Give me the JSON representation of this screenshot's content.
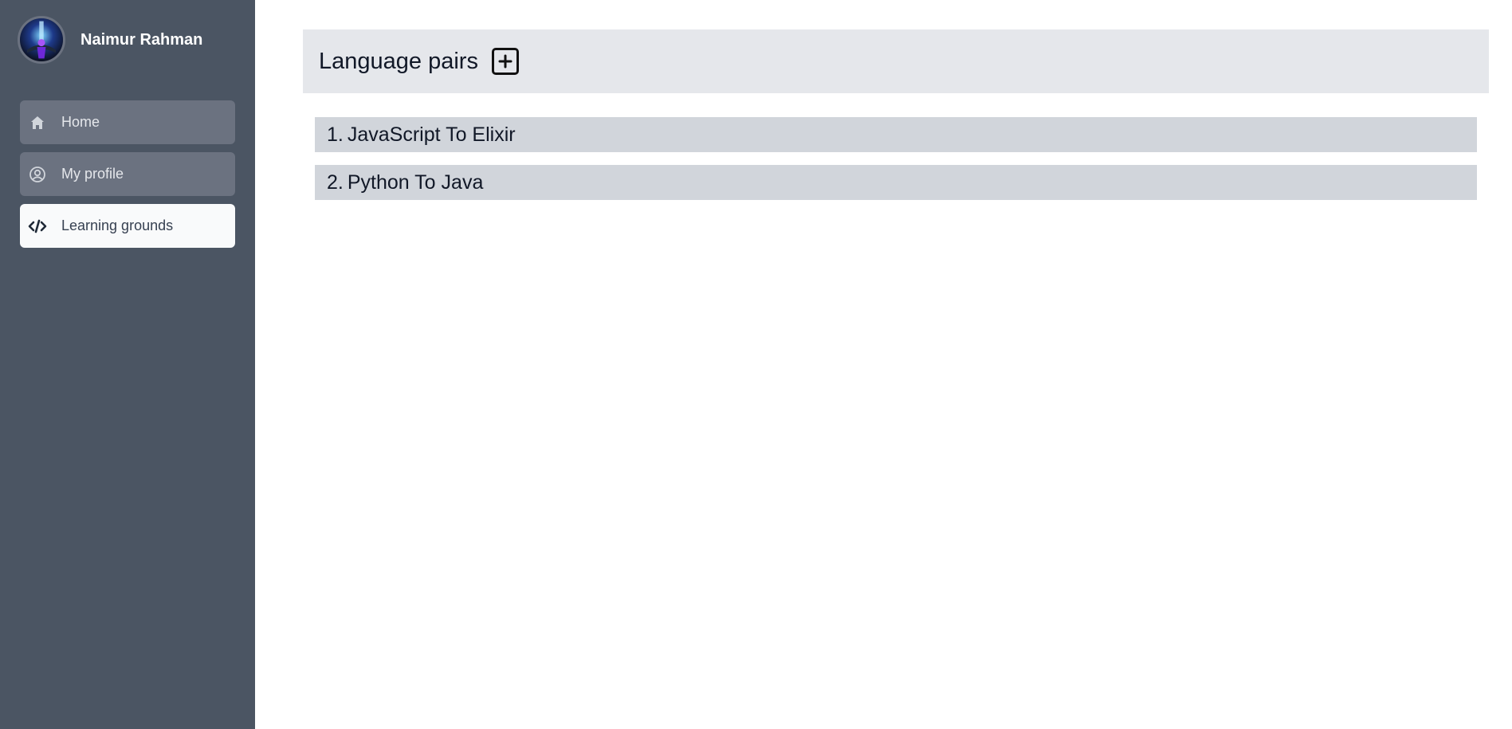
{
  "user": {
    "name": "Naimur Rahman"
  },
  "sidebar": {
    "items": [
      {
        "label": "Home",
        "icon": "home-icon",
        "active": false
      },
      {
        "label": "My profile",
        "icon": "user-circle-icon",
        "active": false
      },
      {
        "label": "Learning grounds",
        "icon": "code-icon",
        "active": true
      }
    ]
  },
  "main": {
    "title": "Language pairs",
    "add_icon": "plus-square-icon",
    "pairs": [
      {
        "index": "1.",
        "label": "JavaScript To Elixir"
      },
      {
        "index": "2.",
        "label": "Python To Java"
      }
    ]
  },
  "colors": {
    "sidebar_bg": "#4b5563",
    "nav_item_bg": "#6b7280",
    "nav_item_active_bg": "#f9fafb",
    "header_bg": "#e5e7eb",
    "pair_bg": "#d1d5db"
  }
}
